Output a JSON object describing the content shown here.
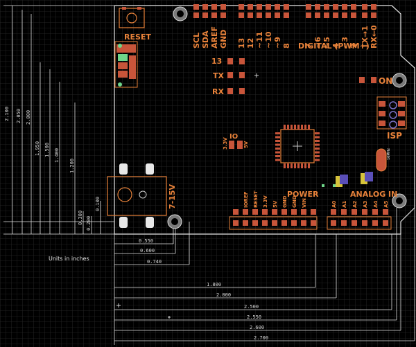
{
  "board": {
    "reset_label": "RESET",
    "on_label": "ON",
    "isp_label": "ISP",
    "l_label": "L",
    "power_label": "POWER",
    "analog_label": "ANALOG IN",
    "digital_label": "DIGITAL (PWM~)",
    "tx_label": "TX",
    "rx_label": "RX",
    "pin13_label": "13",
    "ioref_volt": "IO",
    "v33": "3.3V",
    "v5": "5V",
    "vin_label": "7-15V",
    "top_pins": [
      "SCL",
      "SDA",
      "AREF",
      "GND",
      "13",
      "12",
      "~11",
      "~10",
      "~9",
      "8",
      "7",
      "~6",
      "~5",
      "4",
      "~3",
      "2",
      "TX→1",
      "RX←0"
    ],
    "power_pins": [
      "IOREF",
      "RESET",
      "3.3V",
      "5V",
      "GND",
      "GND",
      "VIN"
    ],
    "analog_pins": [
      "A0",
      "A1",
      "A2",
      "A3",
      "A4",
      "A5"
    ]
  },
  "dimensions": {
    "units_note": "Units in inches",
    "vertical": [
      "2.100",
      "2.050",
      "2.000",
      "1.950",
      "1.500",
      "1.400",
      "1.200",
      "0.300",
      "0.200",
      "0.100"
    ],
    "horizontal": [
      "0.550",
      "0.600",
      "0.740",
      "1.800",
      "2.000",
      "2.500",
      "2.550",
      "2.600",
      "2.700"
    ]
  },
  "colors": {
    "background": "#000000",
    "grid": "#2b2b2b",
    "dimension_line": "#e0e0e0",
    "silkscreen": "#e8823a",
    "copper": "#c8553a",
    "via": "#b0b0b0"
  }
}
